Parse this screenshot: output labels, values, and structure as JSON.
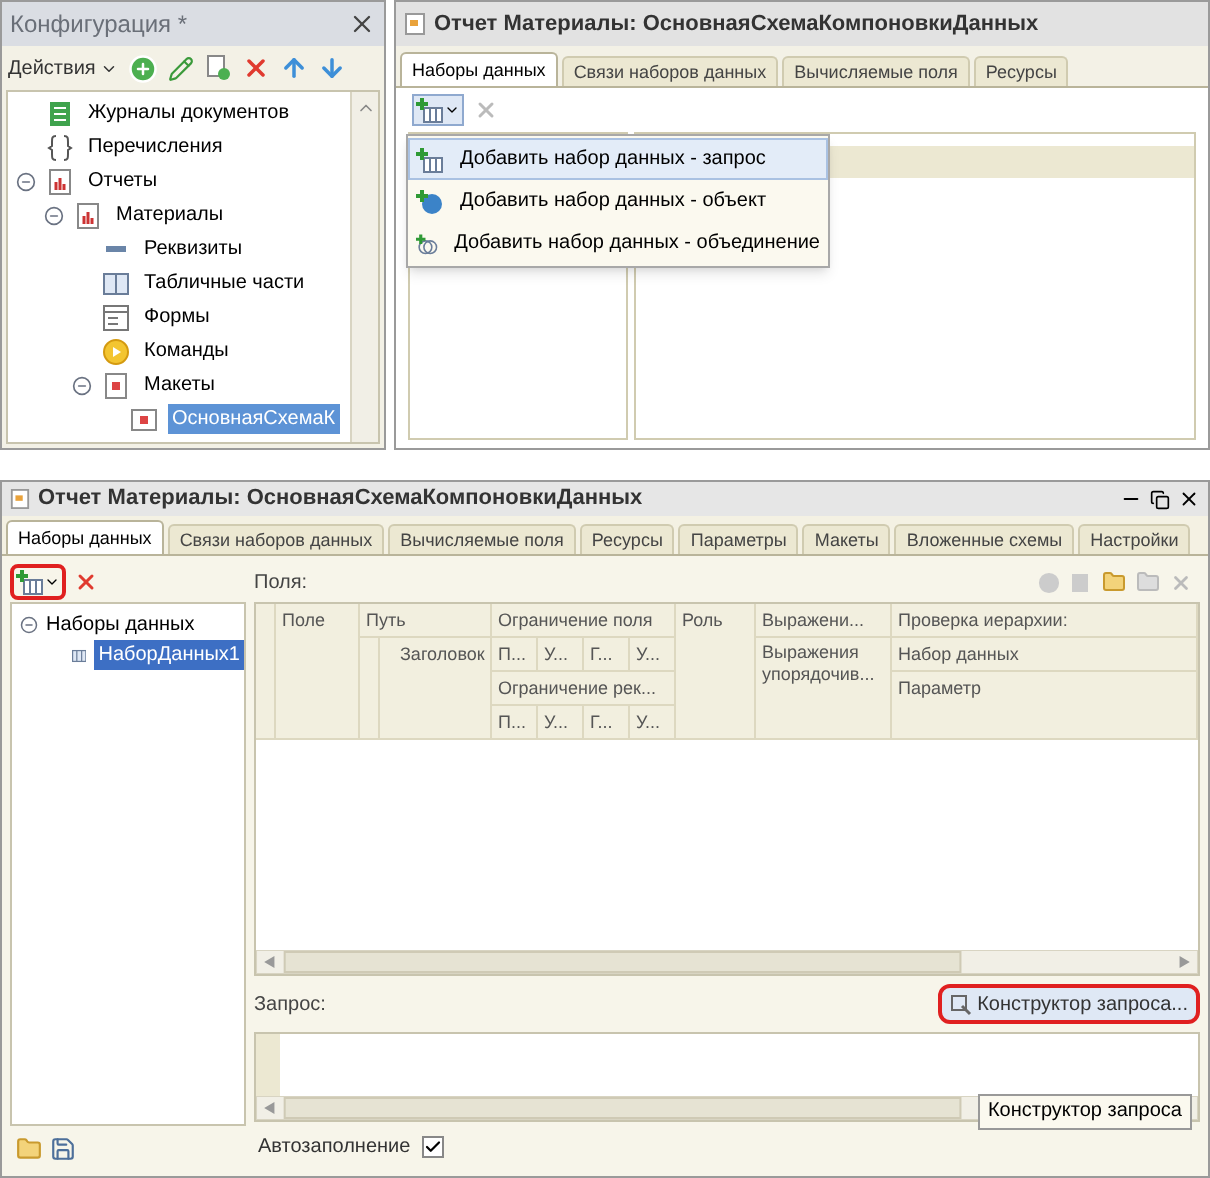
{
  "config_panel": {
    "title": "Конфигурация *",
    "actions_menu": "Действия",
    "tree": [
      {
        "label": "Журналы документов",
        "kind": "journal",
        "selected": false
      },
      {
        "label": "Перечисления",
        "kind": "enum",
        "selected": false
      },
      {
        "label": "Отчеты",
        "kind": "report",
        "selected": false,
        "expanded": true,
        "children": [
          {
            "label": "Материалы",
            "kind": "report",
            "selected": false,
            "expanded": true,
            "children": [
              {
                "label": "Реквизиты",
                "kind": "attribute",
                "selected": false
              },
              {
                "label": "Табличные части",
                "kind": "table",
                "selected": false
              },
              {
                "label": "Формы",
                "kind": "form",
                "selected": false
              },
              {
                "label": "Команды",
                "kind": "command",
                "selected": false
              },
              {
                "label": "Макеты",
                "kind": "templates",
                "selected": false,
                "expanded": true,
                "children": [
                  {
                    "label": "ОсновнаяСхемаК",
                    "kind": "template",
                    "selected": true
                  }
                ]
              }
            ]
          }
        ]
      }
    ]
  },
  "schema_top": {
    "title": "Отчет Материалы: ОсновнаяСхемаКомпоновкиДанных",
    "tabs": [
      {
        "label": "Наборы данных",
        "selected": true
      },
      {
        "label": "Связи наборов данных",
        "selected": false
      },
      {
        "label": "Вычисляемые поля",
        "selected": false
      },
      {
        "label": "Ресурсы",
        "selected": false
      }
    ],
    "add_menu": [
      {
        "label": "Добавить набор данных - запрос",
        "kind": "query",
        "selected": true
      },
      {
        "label": "Добавить набор данных - объект",
        "kind": "object",
        "selected": false
      },
      {
        "label": "Добавить набор данных - объединение",
        "kind": "union",
        "selected": false
      }
    ]
  },
  "schema_window": {
    "title": "Отчет Материалы: ОсновнаяСхемаКомпоновкиДанных",
    "tabs": [
      {
        "label": "Наборы данных",
        "selected": true
      },
      {
        "label": "Связи наборов данных",
        "selected": false
      },
      {
        "label": "Вычисляемые поля",
        "selected": false
      },
      {
        "label": "Ресурсы",
        "selected": false
      },
      {
        "label": "Параметры",
        "selected": false
      },
      {
        "label": "Макеты",
        "selected": false
      },
      {
        "label": "Вложенные схемы",
        "selected": false
      },
      {
        "label": "Настройки",
        "selected": false
      }
    ],
    "datasets_tree": {
      "label": "Наборы данных",
      "expanded": true,
      "children": [
        {
          "label": "НаборДанных1",
          "selected": true
        }
      ]
    },
    "fields_label": "Поля:",
    "header": {
      "field": "Поле",
      "path": "Путь",
      "path_title": "Заголовок",
      "field_restriction": "Ограничение поля",
      "field_restriction_flags": [
        "П...",
        "У...",
        "Г...",
        "У..."
      ],
      "attr_restriction": "Ограничение рек...",
      "attr_restriction_flags": [
        "П...",
        "У...",
        "Г...",
        "У..."
      ],
      "role": "Роль",
      "expression": "Выражени...",
      "order_expression": "Выражения упорядочив...",
      "hierarchy_check": "Проверка иерархии:",
      "hierarchy_dataset": "Набор данных",
      "hierarchy_parameter": "Параметр"
    },
    "query_label": "Запрос:",
    "query_builder_button": "Конструктор запроса...",
    "tooltip": "Конструктор запроса",
    "autofill": {
      "label": "Автозаполнение",
      "checked": true
    }
  }
}
